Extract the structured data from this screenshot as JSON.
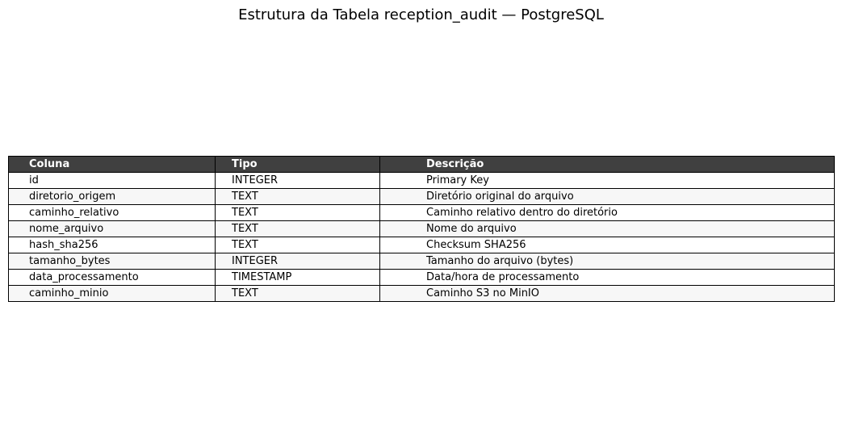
{
  "title": "Estrutura da Tabela reception_audit — PostgreSQL",
  "colors": {
    "header_bg": "#404040",
    "header_text": "#ffffff",
    "row_bg": "#f7f7f7",
    "row_alt_bg": "#ffffff",
    "border": "#000000"
  },
  "chart_data": {
    "type": "table",
    "title": "Estrutura da Tabela reception_audit — PostgreSQL",
    "columns": [
      "Coluna",
      "Tipo",
      "Descrição"
    ],
    "rows": [
      [
        "id",
        "INTEGER",
        "Primary Key"
      ],
      [
        "diretorio_origem",
        "TEXT",
        "Diretório original do arquivo"
      ],
      [
        "caminho_relativo",
        "TEXT",
        "Caminho relativo dentro do diretório"
      ],
      [
        "nome_arquivo",
        "TEXT",
        "Nome do arquivo"
      ],
      [
        "hash_sha256",
        "TEXT",
        "Checksum SHA256"
      ],
      [
        "tamanho_bytes",
        "INTEGER",
        "Tamanho do arquivo (bytes)"
      ],
      [
        "data_processamento",
        "TIMESTAMP",
        "Data/hora de processamento"
      ],
      [
        "caminho_minio",
        "TEXT",
        "Caminho S3 no MinIO"
      ]
    ]
  }
}
